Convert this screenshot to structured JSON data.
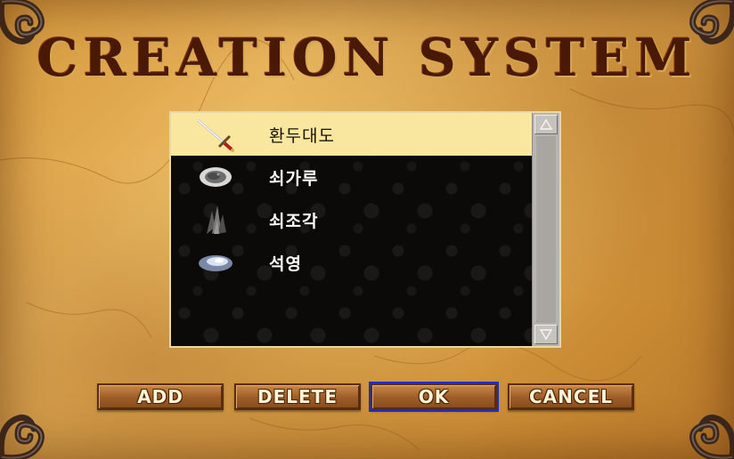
{
  "title": "CREATION SYSTEM",
  "items": [
    {
      "label": "환두대도",
      "icon": "sword-icon",
      "selected": true
    },
    {
      "label": "쇠가루",
      "icon": "iron-powder-icon",
      "selected": false
    },
    {
      "label": "쇠조각",
      "icon": "iron-shard-icon",
      "selected": false
    },
    {
      "label": "석영",
      "icon": "quartz-icon",
      "selected": false
    }
  ],
  "buttons": {
    "add": "ADD",
    "delete": "DELETE",
    "ok": "OK",
    "cancel": "CANCEL"
  },
  "colors": {
    "parchment": "#dda44a",
    "title": "#4a1a06",
    "selected_row": "#f9e79f",
    "list_bg": "#0b0a09",
    "focus_outline": "#1a2ed8"
  }
}
